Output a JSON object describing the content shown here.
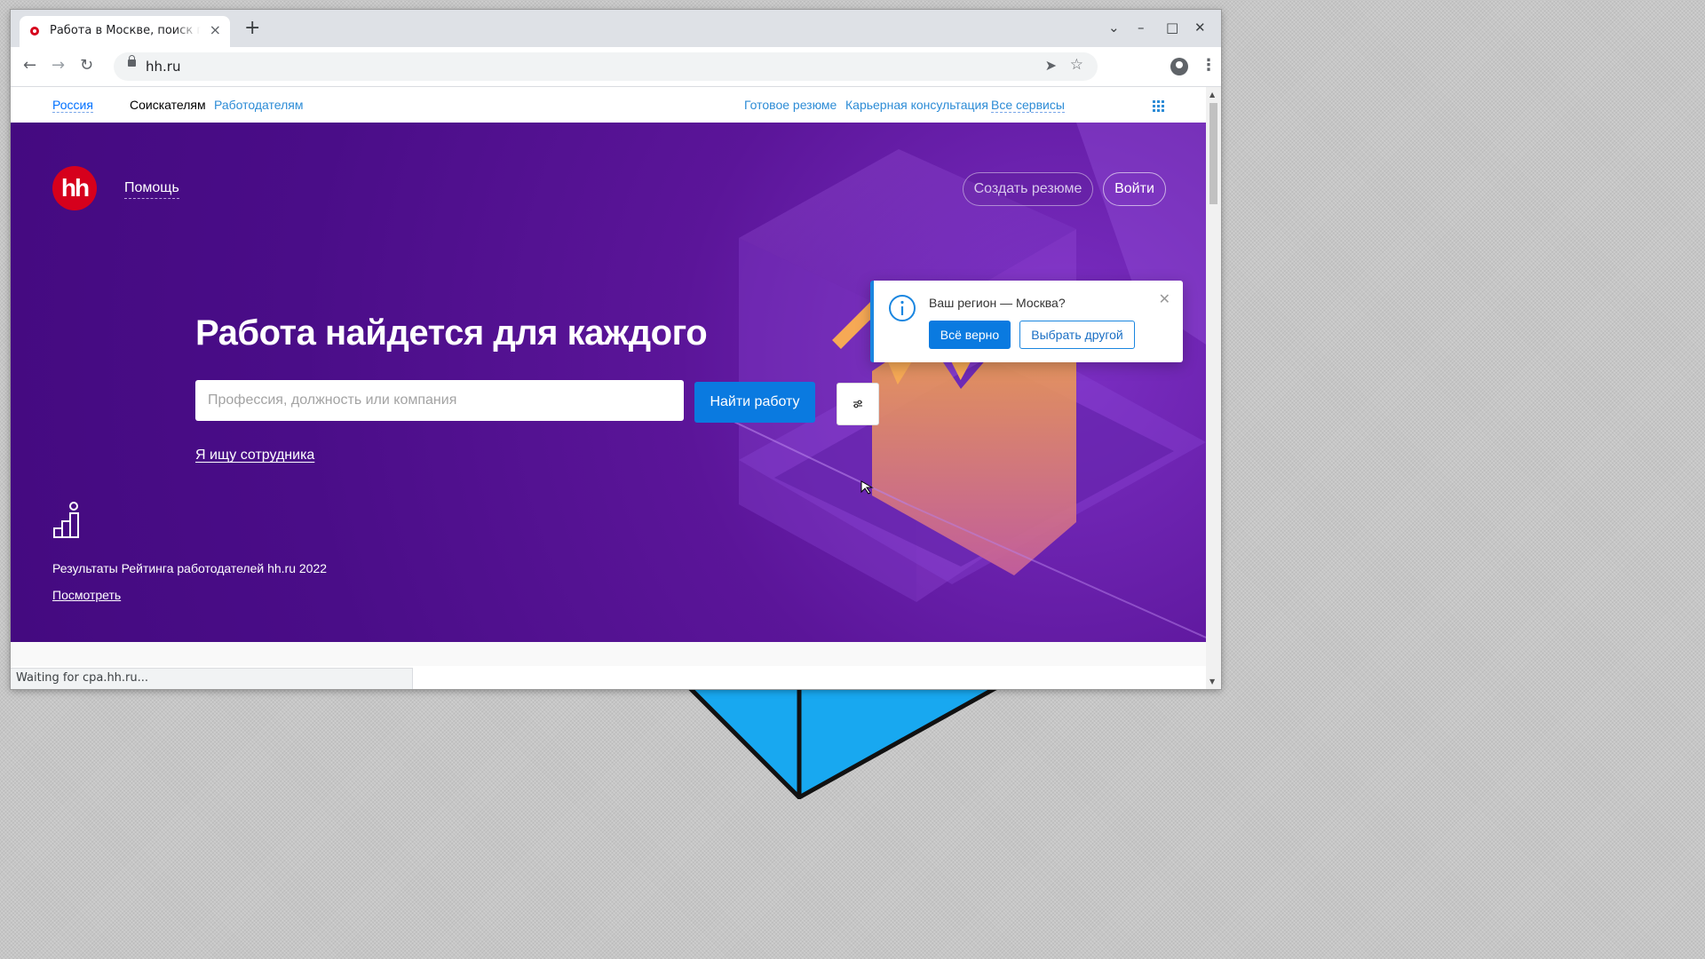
{
  "browser": {
    "tab_title": "Работа в Москве, поиск п",
    "url": "hh.ru",
    "status": "Waiting for cpa.hh.ru..."
  },
  "topnav": {
    "region": "Россия",
    "seekers": "Соискателям",
    "employers": "Работодателям",
    "ready_resume": "Готовое резюме",
    "career": "Карьерная консультация",
    "all_services": "Все сервисы"
  },
  "header": {
    "logo": "hh",
    "help": "Помощь",
    "create_resume": "Создать резюме",
    "login": "Войти"
  },
  "hero": {
    "headline": "Работа найдется для каждого",
    "search_placeholder": "Профессия, должность или компания",
    "search_button": "Найти работу",
    "employer_link": "Я ищу сотрудника",
    "rating_text": "Результаты Рейтинга работодателей hh.ru 2022",
    "rating_link": "Посмотреть"
  },
  "region_popup": {
    "question": "Ваш регион — Москва?",
    "confirm": "Всё верно",
    "choose_other": "Выбрать другой"
  },
  "colors": {
    "hero_bg": "#4a0d88",
    "brand_red": "#d6001c",
    "primary_blue": "#0a7ae0",
    "link_blue": "#2d8cd6"
  }
}
